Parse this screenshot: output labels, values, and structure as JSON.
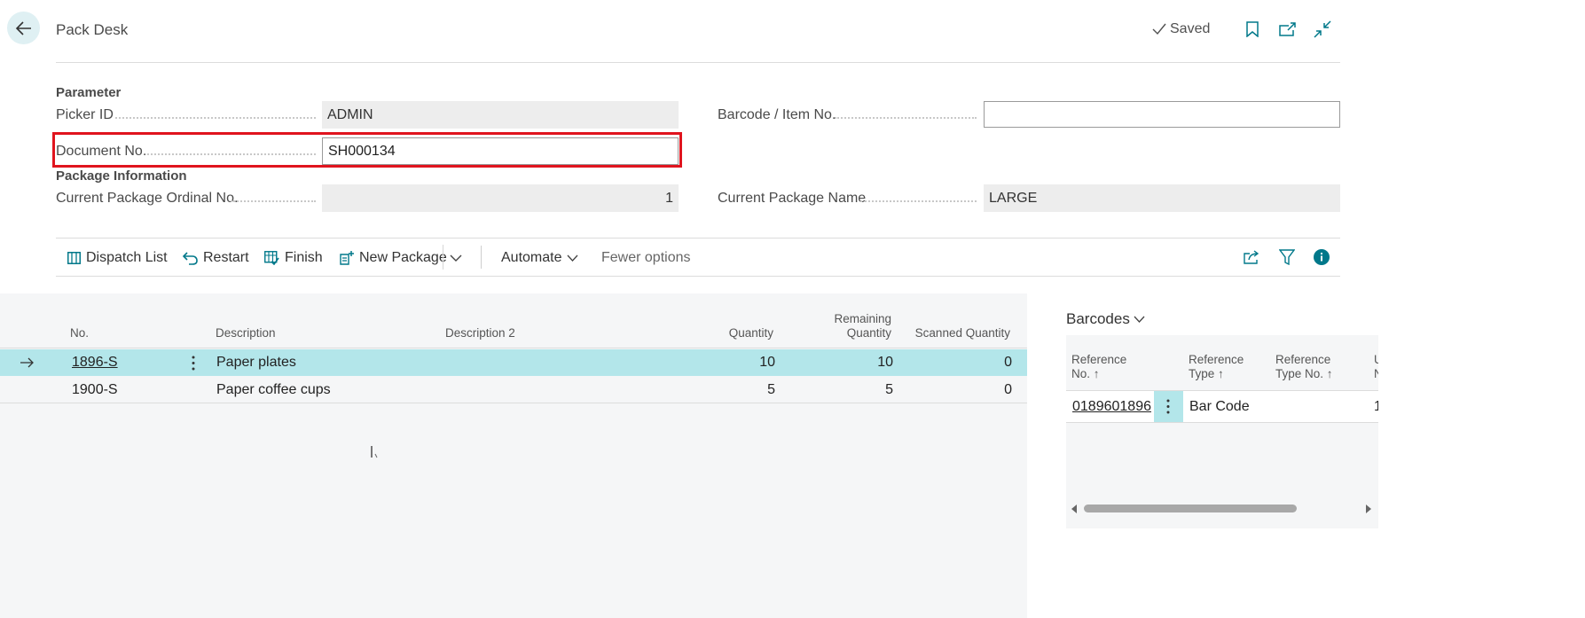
{
  "header": {
    "title": "Pack Desk",
    "saved_label": "Saved"
  },
  "parameter": {
    "group_title": "Parameter",
    "picker_id_label": "Picker ID",
    "picker_id_value": "ADMIN",
    "document_no_label": "Document No.",
    "document_no_value": "SH000134",
    "barcode_label": "Barcode / Item No.",
    "barcode_value": ""
  },
  "package_info": {
    "group_title": "Package Information",
    "ordinal_label": "Current Package Ordinal No.",
    "ordinal_value": "1",
    "name_label": "Current Package Name",
    "name_value": "LARGE"
  },
  "actions": {
    "dispatch_list": "Dispatch List",
    "restart": "Restart",
    "finish": "Finish",
    "new_package": "New Package",
    "automate": "Automate",
    "fewer_options": "Fewer options"
  },
  "lines": {
    "columns": {
      "no": "No.",
      "description": "Description",
      "description2": "Description 2",
      "quantity": "Quantity",
      "remaining_1": "Remaining",
      "remaining_2": "Quantity",
      "scanned": "Scanned Quantity"
    },
    "rows": [
      {
        "no": "1896-S",
        "description": "Paper plates",
        "description2": "",
        "quantity": "10",
        "remaining": "10",
        "scanned": "0",
        "selected": true
      },
      {
        "no": "1900-S",
        "description": "Paper coffee cups",
        "description2": "",
        "quantity": "5",
        "remaining": "5",
        "scanned": "0",
        "selected": false
      }
    ]
  },
  "barcodes": {
    "title": "Barcodes",
    "columns": {
      "ref_no_1": "Reference",
      "ref_no_2": "No. ↑",
      "ref_type_1": "Reference",
      "ref_type_2": "Type ↑",
      "ref_type_no_1": "Reference",
      "ref_type_no_2": "Type No. ↑",
      "cut_1": "U",
      "cut_2": "N"
    },
    "rows": [
      {
        "reference_no": "0189601896",
        "reference_type": "Bar Code",
        "reference_type_no": "",
        "cut": "1"
      }
    ]
  },
  "colors": {
    "accent": "#00788a",
    "selected_row": "#b3e6ea",
    "highlight_border": "#e0141e"
  }
}
